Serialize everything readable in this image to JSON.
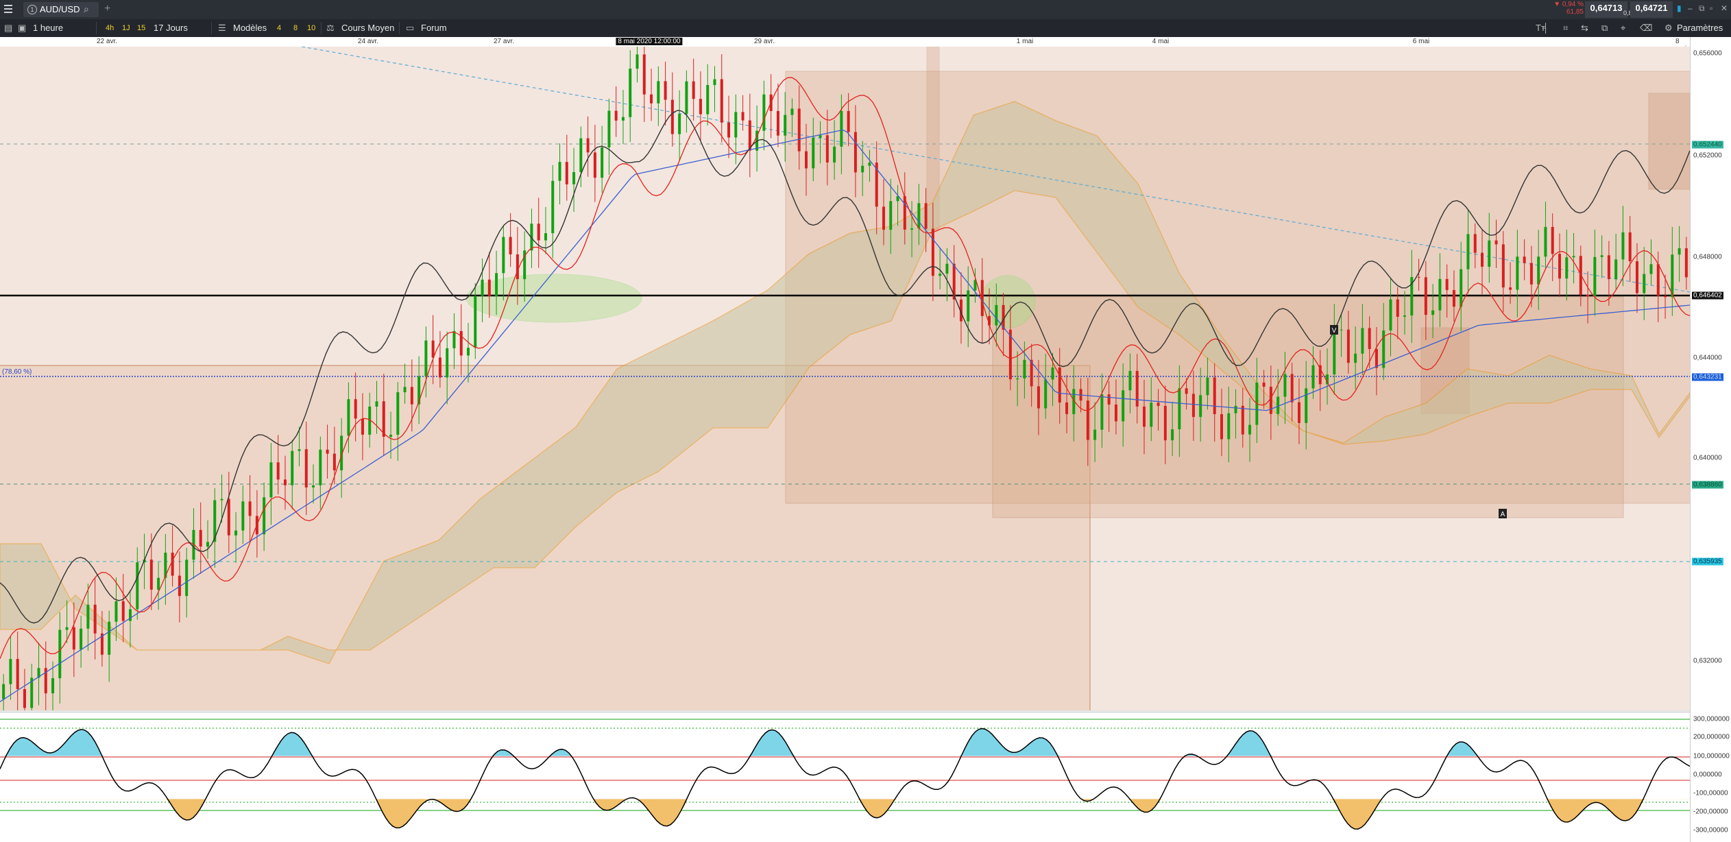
{
  "titlebar": {
    "symbol": "AUD/USD",
    "change_pct": "▼ 0,94 %",
    "change_pts": "61,85",
    "bid": "0,64713",
    "spread": "0,8",
    "ask": "0,64721"
  },
  "toolbar": {
    "timeframe": "1 heure",
    "quick_4h": "4h",
    "quick_1j": "1J",
    "quick_15": "15",
    "period": "17 Jours",
    "models_label": "Modèles",
    "models_4": "4",
    "models_8": "8",
    "models_10": "10",
    "avg_price_label": "Cours Moyen",
    "forum_label": "Forum",
    "settings_label": "Paramètres"
  },
  "date_axis": {
    "d1": "22 avr.",
    "d2": "24 avr.",
    "d3": "27 avr.",
    "highlight": "8 mai 2020 12:00:00",
    "d4": "29 avr.",
    "d5": "1 mai",
    "d6": "4 mai",
    "d7": "6 mai",
    "d8": "8 mai"
  },
  "price_axis": {
    "p1": "0,656000",
    "p2": "0,652000",
    "p3": "0,648000",
    "p4": "0,644000",
    "p5": "0,640000",
    "p6": "0,632000",
    "box_resistance": "0,652440",
    "box_current": "0,646402",
    "box_fib": "0,643231",
    "box_support": "0,638860",
    "box_low": "0,635935"
  },
  "fib_label": "(78,60 %)",
  "markers": {
    "v": "V",
    "a": "A"
  },
  "osc_axis": {
    "o1": "300,000000",
    "o2": "200,000000",
    "o3": "100,000000",
    "o4": "0,000000",
    "o5": "-100,00000",
    "o6": "-200,00000",
    "o7": "-300,00000"
  },
  "colors": {
    "bull": "#0fa30f",
    "bear": "#d81f1f",
    "tenkan": "#e3221c",
    "kijun": "#3a5fd0",
    "chikou": "#333333",
    "cloud_edge": "#e8951c",
    "box_fill": "#c98f6c",
    "ellipse": "#9be07a",
    "toolbar_bg": "#23272d",
    "accent_yellow": "#f1d028"
  },
  "chart_data": {
    "type": "line",
    "instrument": "AUD/USD",
    "timeframe": "1 heure",
    "period": "17 Jours",
    "x": [
      "22 avr.",
      "24 avr.",
      "27 avr.",
      "29 avr.",
      "1 mai",
      "4 mai",
      "6 mai",
      "8 mai"
    ],
    "series": [
      {
        "values": [
          0.6305,
          0.6372,
          0.6432,
          0.6549,
          0.6525,
          0.6422,
          0.642,
          0.648,
          0.6475
        ]
      },
      {
        "values": [
          0.6312,
          0.6366,
          0.642,
          0.6522,
          0.654,
          0.6435,
          0.6428,
          0.6462,
          0.647
        ]
      },
      {
        "values": [
          0.6335,
          0.6382,
          0.6465,
          0.653,
          0.6498,
          0.6442,
          0.6455,
          0.649,
          0.653
        ]
      }
    ],
    "ylim": [
      0.63,
      0.6565
    ],
    "horizontal_levels": [
      0.65244,
      0.646402,
      0.643231,
      0.63886,
      0.635935
    ],
    "oscillator": {
      "ylim": [
        -300,
        300
      ],
      "levels": [
        200,
        100,
        0,
        -100,
        -200
      ]
    }
  }
}
